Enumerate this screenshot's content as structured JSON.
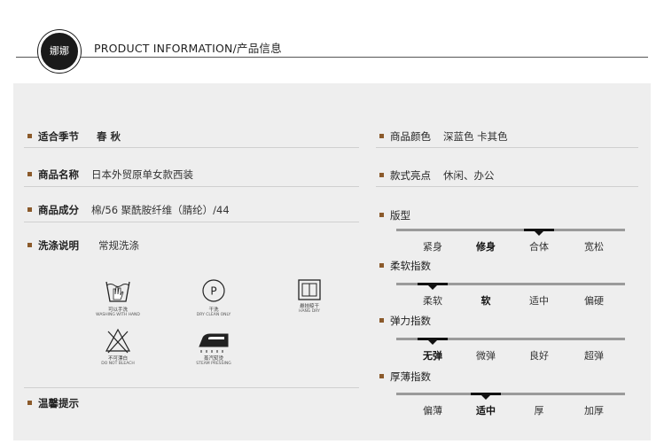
{
  "header": {
    "logo_text": "娜娜",
    "title": "PRODUCT INFORMATION/产品信息"
  },
  "left": {
    "season_label": "适合季节",
    "season_value": "春  秋",
    "name_label": "商品名称",
    "name_value": "日本外贸原单女款西装",
    "composition_label": "商品成分",
    "composition_value": "棉/56   聚酰胺纤维（腈纶）/44",
    "wash_label": "洗涤说明",
    "wash_value": "常规洗涤",
    "tips_label": "温馨提示"
  },
  "care": [
    {
      "icon": "hand-wash-icon",
      "cn": "可以手洗",
      "en": "WASHING WITH HAND"
    },
    {
      "icon": "dry-clean-icon",
      "cn": "干洗",
      "en": "DRY CLEAN ONLY"
    },
    {
      "icon": "hang-dry-icon",
      "cn": "悬挂晾干",
      "en": "HANG DRY"
    },
    {
      "icon": "no-bleach-icon",
      "cn": "不可漂白",
      "en": "DO NOT BLEACH"
    },
    {
      "icon": "steam-press-icon",
      "cn": "蒸汽熨烫",
      "en": "STEAM PRESSING"
    }
  ],
  "right": {
    "color_label": "商品颜色",
    "color_values": "深蓝色   卡其色",
    "style_label": "款式亮点",
    "style_value": "休闲、办公"
  },
  "scales": [
    {
      "label": "版型",
      "options": [
        "紧身",
        "修身",
        "合体",
        "宽松"
      ],
      "selected": 2,
      "bold": 1
    },
    {
      "label": "柔软指数",
      "options": [
        "柔软",
        "软",
        "适中",
        "偏硬"
      ],
      "selected": 0,
      "bold": 1
    },
    {
      "label": "弹力指数",
      "options": [
        "无弹",
        "微弹",
        "良好",
        "超弹"
      ],
      "selected": 0,
      "bold": -1
    },
    {
      "label": "厚薄指数",
      "options": [
        "偏薄",
        "适中",
        "厚",
        "加厚"
      ],
      "selected": 1,
      "bold": -1
    }
  ],
  "colors": {
    "bullet": "#8b5a2b",
    "panel": "#eeeeee",
    "logo": "#1a1a1a"
  }
}
